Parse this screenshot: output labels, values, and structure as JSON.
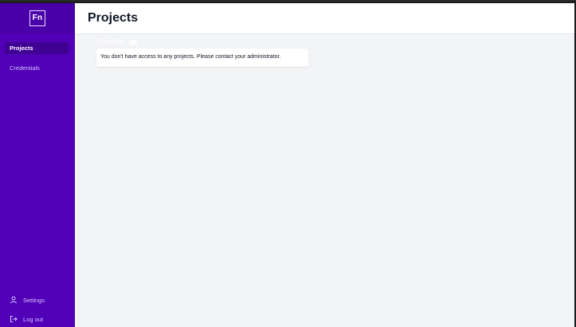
{
  "app": {
    "logo_text": "Fn"
  },
  "sidebar": {
    "items": [
      {
        "label": "Projects",
        "active": true
      },
      {
        "label": "Credentials",
        "active": false
      }
    ],
    "bottom": [
      {
        "label": "Settings",
        "icon": "user-icon"
      },
      {
        "label": "Log out",
        "icon": "logout-icon"
      }
    ]
  },
  "header": {
    "title": "Projects"
  },
  "main": {
    "ghost_heading": "Projects",
    "ghost_badge": "0",
    "notice": "You don't have access to any projects. Please contact your administrator."
  },
  "colors": {
    "sidebar": "#5200b8",
    "sidebar_active": "#3f0093",
    "logo_bar": "#4a00a8",
    "background": "#f3f4f6",
    "title": "#111827"
  }
}
